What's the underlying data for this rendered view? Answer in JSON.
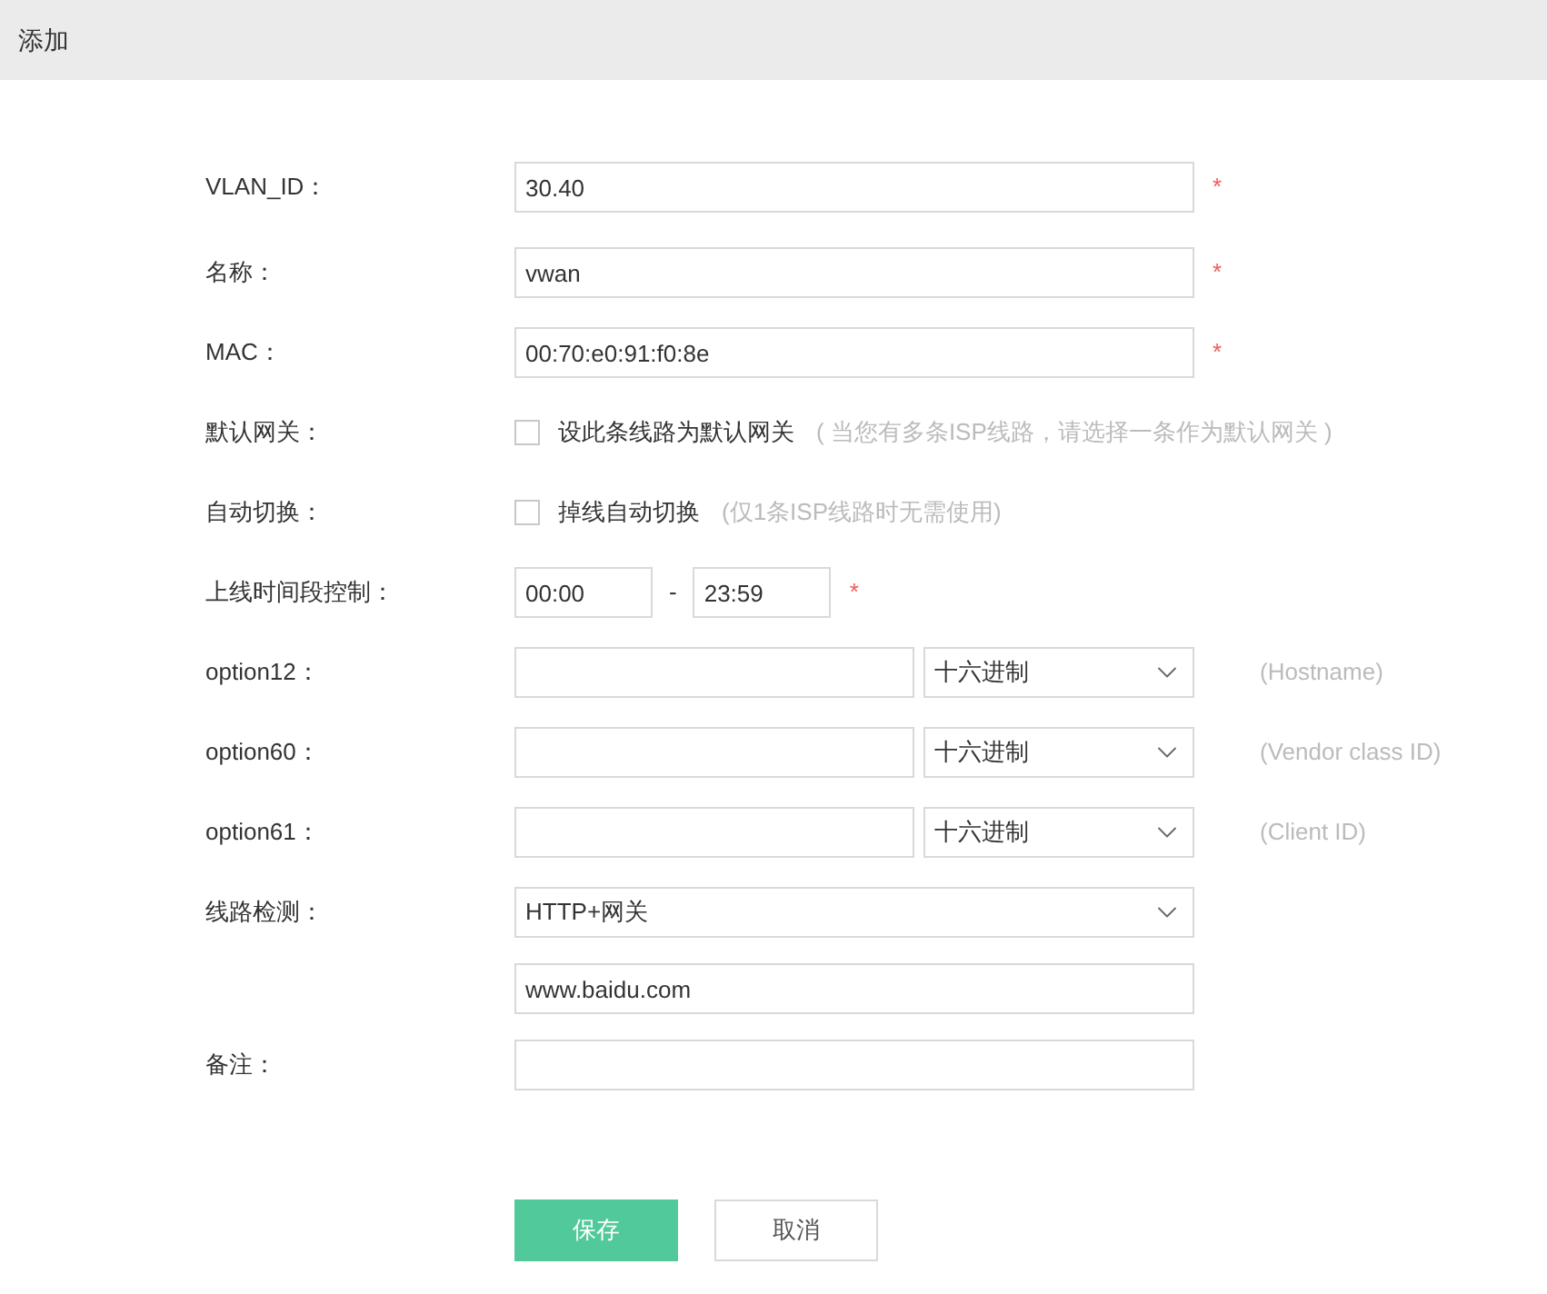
{
  "header": {
    "title": "添加"
  },
  "fields": [
    {
      "kind": "text",
      "label": "VLAN_ID：",
      "value": "30.40",
      "mark": "*"
    },
    {
      "kind": "text",
      "label": "名称：",
      "value": "vwan",
      "mark": "*"
    },
    {
      "kind": "text",
      "label": "MAC：",
      "value": "00:70:e0:91:f0:8e",
      "mark": "*"
    },
    {
      "kind": "checkbox",
      "label": "默认网关：",
      "checked": false,
      "option": "设此条线路为默认网关",
      "hint": "( 当您有多条ISP线路，请选择一条作为默认网关 )"
    },
    {
      "kind": "checkbox",
      "label": "自动切换：",
      "checked": false,
      "option": "掉线自动切换",
      "hint": "(仅1条ISP线路时无需使用)"
    },
    {
      "kind": "timerange",
      "label": "上线时间段控制：",
      "start": "00:00",
      "separator": "-",
      "end": "23:59",
      "mark": "*"
    },
    {
      "kind": "option",
      "label": "option12：",
      "select": "十六进制",
      "hint": "(Hostname)"
    },
    {
      "kind": "option",
      "label": "option60：",
      "select": "十六进制",
      "hint": "(Vendor class ID)"
    },
    {
      "kind": "option",
      "label": "option61：",
      "select": "十六进制",
      "hint": "(Client ID)"
    },
    {
      "kind": "select",
      "label": "线路检测：",
      "select": "HTTP+网关"
    },
    {
      "kind": "text",
      "value": "www.baidu.com"
    },
    {
      "kind": "text",
      "label": "备注："
    }
  ],
  "buttons": [
    {
      "kind": "primary",
      "label": "保存"
    },
    {
      "kind": "secondary",
      "label": "取消"
    }
  ]
}
